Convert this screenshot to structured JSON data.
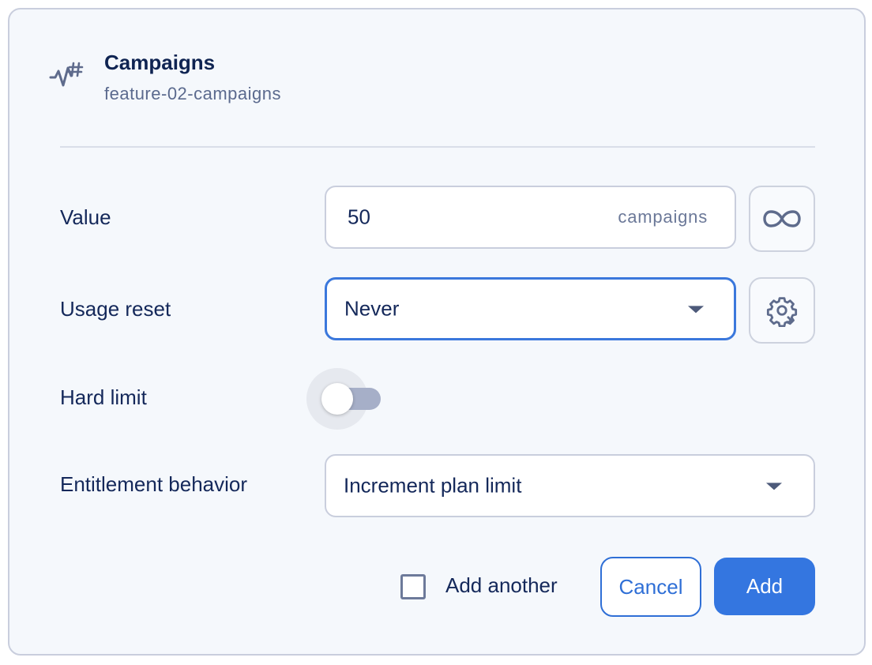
{
  "feature": {
    "icon": "metered-feature-icon",
    "title": "Campaigns",
    "id": "feature-02-campaigns"
  },
  "fields": {
    "value": {
      "label": "Value",
      "current": "50",
      "unit": "campaigns",
      "unlimited_button_icon": "infinity-icon"
    },
    "usage_reset": {
      "label": "Usage reset",
      "selected": "Never",
      "settings_button_icon": "gear-icon"
    },
    "hard_limit": {
      "label": "Hard limit",
      "enabled": false
    },
    "entitlement_behavior": {
      "label": "Entitlement behavior",
      "selected": "Increment plan limit"
    }
  },
  "footer": {
    "add_another_label": "Add another",
    "add_another_checked": false,
    "cancel_label": "Cancel",
    "add_label": "Add"
  },
  "colors": {
    "accent": "#3476e0",
    "text": "#14285a",
    "muted": "#6b7898",
    "background": "#f5f8fc"
  }
}
